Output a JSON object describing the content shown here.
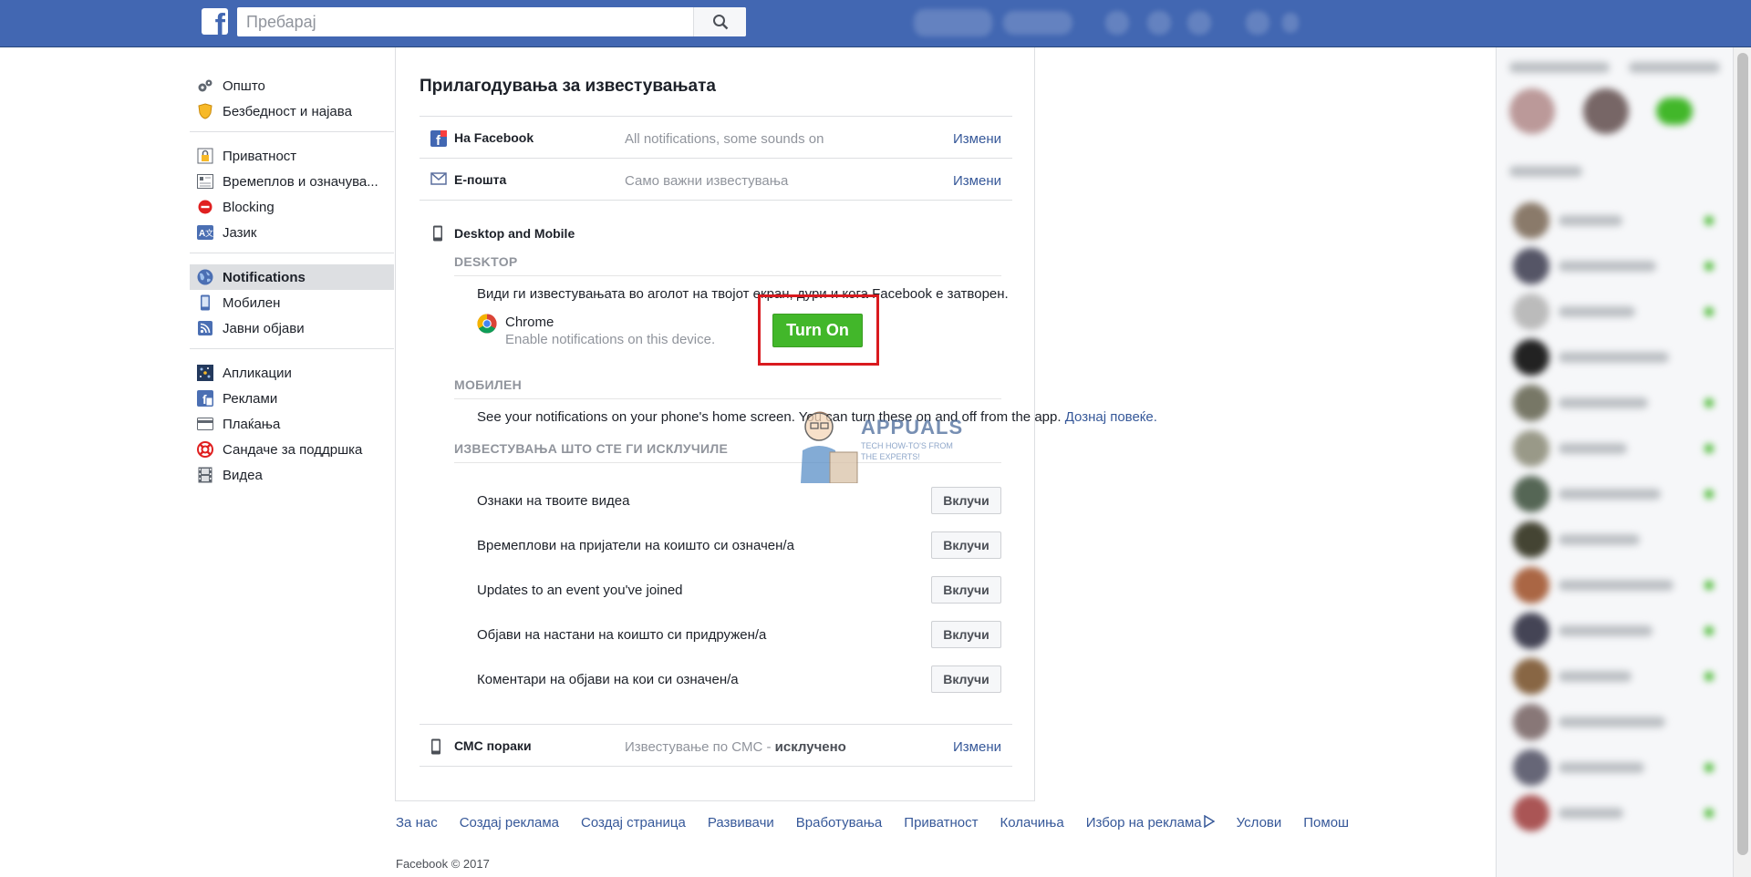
{
  "topbar": {
    "logo_letter": "f",
    "search_placeholder": "Пребарај"
  },
  "leftnav": {
    "groups": [
      [
        {
          "label": "Општо",
          "icon": "gears-icon"
        },
        {
          "label": "Безбедност и најава",
          "icon": "shield-icon"
        }
      ],
      [
        {
          "label": "Приватност",
          "icon": "lock-icon"
        },
        {
          "label": "Времеплов и означува...",
          "icon": "timeline-icon"
        },
        {
          "label": "Blocking",
          "icon": "block-icon"
        },
        {
          "label": "Јазик",
          "icon": "language-icon"
        }
      ],
      [
        {
          "label": "Notifications",
          "icon": "globe-icon",
          "active": true
        },
        {
          "label": "Мобилен",
          "icon": "phone-icon"
        },
        {
          "label": "Јавни објави",
          "icon": "rss-icon"
        }
      ],
      [
        {
          "label": "Апликации",
          "icon": "apps-icon"
        },
        {
          "label": "Реклами",
          "icon": "ads-icon"
        },
        {
          "label": "Плаќања",
          "icon": "card-icon"
        },
        {
          "label": "Сандаче за поддршка",
          "icon": "lifebuoy-icon"
        },
        {
          "label": "Видеа",
          "icon": "film-icon"
        }
      ]
    ]
  },
  "main": {
    "title": "Прилагодувања за известувањата",
    "edit_label": "Измени",
    "facebook_row": {
      "label": "На Facebook",
      "value": "All notifications, some sounds on"
    },
    "email_row": {
      "label": "Е-пошта",
      "value": "Само важни известувања"
    },
    "desktop_mobile": {
      "title": "Desktop and Mobile",
      "desktop_heading": "DESKTOP",
      "desktop_desc": "Види ги известувањата во аголот на твојот екран, дури и кога Facebook е затворен.",
      "browser_name": "Chrome",
      "browser_sub": "Enable notifications on this device.",
      "turn_on_label": "Turn On",
      "mobile_heading": "МОБИЛЕН",
      "mobile_desc": "See your notifications on your phone's home screen. You can turn these on and off from the app.",
      "mobile_link": "Дознај повеќе.",
      "off_heading": "ИЗВЕСТУВАЊА ШТО СТЕ ГИ ИСКЛУЧИЛЕ",
      "off_items": [
        "Ознаки на твоите видеа",
        "Времеплови на пријатели на коишто си означен/а",
        "Updates to an event you've joined",
        "Објави на настани на коишто си придружен/а",
        "Коментари на објави на кои си означен/а"
      ],
      "turn_on_small": "Вклучи"
    },
    "sms_row": {
      "label": "СМС пораки",
      "value_prefix": "Известување по СМС - ",
      "value_bold": "исклучено"
    }
  },
  "watermark": {
    "brand": "APPUALS",
    "tagline1": "TECH HOW-TO'S FROM",
    "tagline2": "THE EXPERTS!"
  },
  "footer": {
    "links": [
      "За нас",
      "Создај реклама",
      "Создај страница",
      "Развивачи",
      "Вработувања",
      "Приватност",
      "Колачиња",
      "Избор на реклама",
      "Услови",
      "Помош"
    ],
    "copyright": "Facebook © 2017"
  },
  "colors": {
    "brand_blue": "#4267b2",
    "link": "#365899",
    "turn_on_green": "#42b72a",
    "highlight_red": "#d91a1f"
  }
}
